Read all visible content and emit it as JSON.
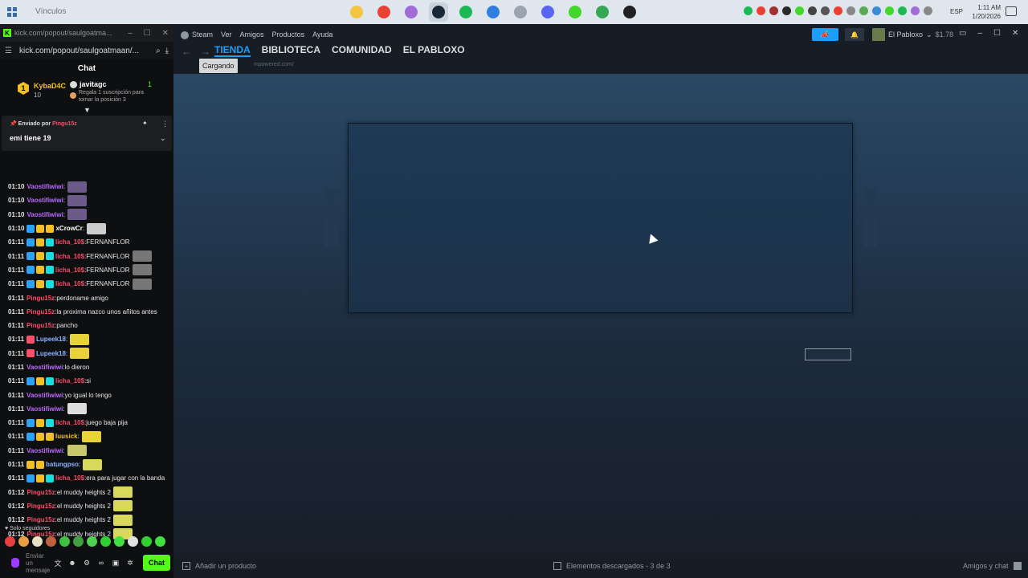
{
  "taskbar": {
    "window_title": "Vínculos",
    "language": "ESP",
    "time": "1:11 AM",
    "date": "1/20/2026",
    "apps": [
      {
        "name": "file-explorer-icon",
        "color": "#f4c542"
      },
      {
        "name": "chrome-icon",
        "color": "#e94235"
      },
      {
        "name": "copilot-icon",
        "color": "#a06cd5"
      },
      {
        "name": "steam-icon",
        "color": "#1b2838",
        "active": true
      },
      {
        "name": "spotify-icon",
        "color": "#1db954"
      },
      {
        "name": "store-icon",
        "color": "#2f7de1"
      },
      {
        "name": "photos-icon",
        "color": "#9aa5b1"
      },
      {
        "name": "discord-icon",
        "color": "#5865f2"
      },
      {
        "name": "razer-icon",
        "color": "#44d62c"
      },
      {
        "name": "chrome-alt-icon",
        "color": "#34a853"
      },
      {
        "name": "obs-icon",
        "color": "#222222"
      }
    ],
    "tray_colors": [
      "#1db954",
      "#e94235",
      "#a03030",
      "#2a2a2a",
      "#44d62c",
      "#444",
      "#555",
      "#e94235",
      "#888",
      "#5aaa55",
      "#3b8ad8",
      "#44d62c",
      "#1db954",
      "#a06cd5",
      "#888"
    ]
  },
  "kick": {
    "window_title": "kick.com/popout/saulgoatma...",
    "url": "kick.com/popout/saulgoatmaan/...",
    "chat_title": "Chat",
    "leader": {
      "rank": "1",
      "name": "KybaD4C",
      "count": "10"
    },
    "gifter": {
      "name": "javitagc",
      "count": "1",
      "desc": "Regala 1 suscripción para tomar la posición 3"
    },
    "pinned": {
      "sent_by_label": "Enviado por",
      "sent_by_user": "Pingu15z",
      "text": "emi tiene 19"
    },
    "messages": [
      {
        "time": "01:10",
        "user": "Vaostifiwiwi",
        "color": "#b86bff",
        "text": "",
        "badges": [],
        "emote": "#6c5a8a"
      },
      {
        "time": "01:10",
        "user": "Vaostifiwiwi",
        "color": "#b86bff",
        "text": "",
        "badges": [],
        "emote": "#6c5a8a"
      },
      {
        "time": "01:10",
        "user": "Vaostifiwiwi",
        "color": "#b86bff",
        "text": "",
        "badges": [],
        "emote": "#6c5a8a"
      },
      {
        "time": "01:10",
        "user": "xCrowCr",
        "color": "#ffffff",
        "text": "",
        "badges": [
          "#2aa3ff",
          "#f2c023",
          "#f2c023"
        ],
        "emote": "#cccccc"
      },
      {
        "time": "01:11",
        "user": "licha_10$",
        "color": "#ff4d6a",
        "text": "FERNANFLOR",
        "badges": [
          "#2aa3ff",
          "#f2c023",
          "#14e0e0"
        ],
        "emote": ""
      },
      {
        "time": "01:11",
        "user": "licha_10$",
        "color": "#ff4d6a",
        "text": "FERNANFLOR",
        "badges": [
          "#2aa3ff",
          "#f2c023",
          "#14e0e0"
        ],
        "emote": "#777777"
      },
      {
        "time": "01:11",
        "user": "licha_10$",
        "color": "#ff4d6a",
        "text": "FERNANFLOR",
        "badges": [
          "#2aa3ff",
          "#f2c023",
          "#14e0e0"
        ],
        "emote": "#777777"
      },
      {
        "time": "01:11",
        "user": "licha_10$",
        "color": "#ff4d6a",
        "text": "FERNANFLOR",
        "badges": [
          "#2aa3ff",
          "#f2c023",
          "#14e0e0"
        ],
        "emote": "#777777"
      },
      {
        "time": "01:11",
        "user": "Pingu15z",
        "color": "#ff4d6a",
        "text": "perdoname amigo",
        "badges": [],
        "emote": ""
      },
      {
        "time": "01:11",
        "user": "Pingu15z",
        "color": "#ff4d6a",
        "text": "la proxima nazco unos añitos antes",
        "badges": [],
        "emote": ""
      },
      {
        "time": "01:11",
        "user": "Pingu15z",
        "color": "#ff4d6a",
        "text": "pancho",
        "badges": [],
        "emote": ""
      },
      {
        "time": "01:11",
        "user": "Lupeek18",
        "color": "#8ab4ff",
        "text": "",
        "badges": [
          "#ff4d6a"
        ],
        "emote": "#e8d23a"
      },
      {
        "time": "01:11",
        "user": "Lupeek18",
        "color": "#8ab4ff",
        "text": "",
        "badges": [
          "#ff4d6a"
        ],
        "emote": "#e8d23a"
      },
      {
        "time": "01:11",
        "user": "Vaostifiwiwi",
        "color": "#b86bff",
        "text": "lo dieron",
        "badges": [],
        "emote": ""
      },
      {
        "time": "01:11",
        "user": "licha_10$",
        "color": "#ff4d6a",
        "text": "si",
        "badges": [
          "#2aa3ff",
          "#f2c023",
          "#14e0e0"
        ],
        "emote": ""
      },
      {
        "time": "01:11",
        "user": "Vaostifiwiwi",
        "color": "#b86bff",
        "text": "yo igual lo tengo",
        "badges": [],
        "emote": ""
      },
      {
        "time": "01:11",
        "user": "Vaostifiwiwi",
        "color": "#b86bff",
        "text": "",
        "badges": [],
        "emote": "#dddddd"
      },
      {
        "time": "01:11",
        "user": "licha_10$",
        "color": "#ff4d6a",
        "text": "juego baja pija",
        "badges": [
          "#2aa3ff",
          "#f2c023",
          "#14e0e0"
        ],
        "emote": ""
      },
      {
        "time": "01:11",
        "user": "luusick",
        "color": "#f2c023",
        "text": "",
        "badges": [
          "#2aa3ff",
          "#f2c023",
          "#f2c023"
        ],
        "emote": "#e8d23a"
      },
      {
        "time": "01:11",
        "user": "Vaostifiwiwi",
        "color": "#b86bff",
        "text": "",
        "badges": [],
        "emote": "#c8c86a"
      },
      {
        "time": "01:11",
        "user": "batungpso",
        "color": "#8ab4ff",
        "text": "",
        "badges": [
          "#f2c023",
          "#f2c023"
        ],
        "emote": "#d8d85a"
      },
      {
        "time": "01:11",
        "user": "licha_10$",
        "color": "#ff4d6a",
        "text": "era para jugar con la banda",
        "badges": [
          "#2aa3ff",
          "#f2c023",
          "#14e0e0"
        ],
        "emote": ""
      },
      {
        "time": "01:12",
        "user": "Pingu15z",
        "color": "#ff4d6a",
        "text": "el muddy heights 2",
        "badges": [],
        "emote": "#d8d85a"
      },
      {
        "time": "01:12",
        "user": "Pingu15z",
        "color": "#ff4d6a",
        "text": "el muddy heights 2",
        "badges": [],
        "emote": "#d8d85a"
      },
      {
        "time": "01:12",
        "user": "Pingu15z",
        "color": "#ff4d6a",
        "text": "el muddy heights 2",
        "badges": [],
        "emote": "#d8d85a"
      },
      {
        "time": "01:12",
        "user": "Pingu15z",
        "color": "#ff4d6a",
        "text": "el muddy heights 2",
        "badges": [],
        "emote": "#d8d85a"
      }
    ],
    "followers_only": "Solo seguidores",
    "emote_colors": [
      "#e84040",
      "#e8a040",
      "#e8e0c0",
      "#c06040",
      "#40c040",
      "#40a040",
      "#4fd04f",
      "#30d030",
      "#40e040",
      "#e0e0e0",
      "#30d030",
      "#40e040"
    ],
    "input_placeholder": "Enviar un mensaje",
    "chat_button": "Chat"
  },
  "steam": {
    "menu": [
      "Steam",
      "Ver",
      "Amigos",
      "Productos",
      "Ayuda"
    ],
    "account_name": "El Pabloxo",
    "balance": "$1.78",
    "tabs": [
      "TIENDA",
      "BIBLIOTECA",
      "COMUNIDAD",
      "EL PABLOXO"
    ],
    "active_tab": "TIENDA",
    "tooltip": "Cargando",
    "url_fragment": "mpowered.com/",
    "footer": {
      "add_product": "Añadir un producto",
      "downloads": "Elementos descargados - 3 de 3",
      "friends": "Amigos y chat"
    },
    "accent_color": "#1a9fff"
  }
}
